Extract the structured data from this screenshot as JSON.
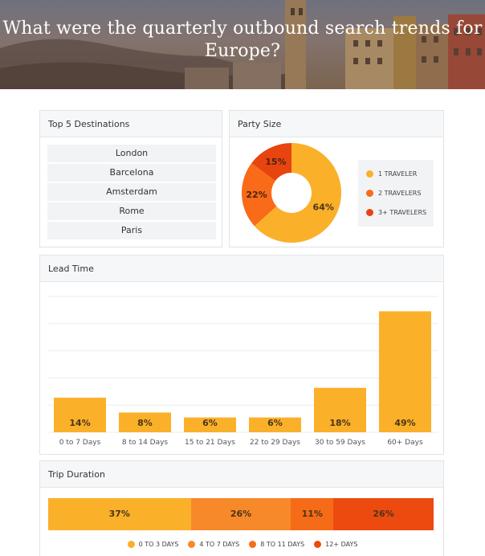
{
  "hero": {
    "title": "What were the quarterly outbound search trends for Europe?"
  },
  "destinations": {
    "title": "Top 5 Destinations",
    "items": [
      "London",
      "Barcelona",
      "Amsterdam",
      "Rome",
      "Paris"
    ]
  },
  "colors": {
    "yellow": "#fbb02a",
    "orange": "#f7842a",
    "dark_orange": "#f2621e",
    "red": "#e8440f"
  },
  "chart_data": [
    {
      "type": "pie",
      "title": "Party Size",
      "donut": true,
      "slices": [
        {
          "label": "1 TRAVELER",
          "value": 64,
          "display": "64%",
          "color": "#fbb02a"
        },
        {
          "label": "2 TRAVELERS",
          "value": 22,
          "display": "22%",
          "color": "#f96a19"
        },
        {
          "label": "3+ TRAVELERS",
          "value": 15,
          "display": "15%",
          "color": "#e8440f"
        }
      ],
      "legend": "right"
    },
    {
      "type": "bar",
      "title": "Lead Time",
      "categories": [
        "0 to 7 Days",
        "8 to 14 Days",
        "15 to 21 Days",
        "22 to 29 Days",
        "30 to 59 Days",
        "60+ Days"
      ],
      "values": [
        14,
        8,
        6,
        6,
        18,
        49
      ],
      "labels": [
        "14%",
        "8%",
        "6%",
        "6%",
        "18%",
        "49%"
      ],
      "ylim": [
        0,
        55
      ],
      "grid": true,
      "color": "#fbb02a"
    },
    {
      "type": "bar",
      "stacked": true,
      "orientation": "horizontal",
      "title": "Trip Duration",
      "series": [
        {
          "name": "0 TO 3 DAYS",
          "value": 37,
          "label": "37%",
          "color": "#fbb02a"
        },
        {
          "name": "4 TO 7 DAYS",
          "value": 26,
          "label": "26%",
          "color": "#f8892a"
        },
        {
          "name": "8 TO 11 DAYS",
          "value": 11,
          "label": "11%",
          "color": "#f66b17"
        },
        {
          "name": "12+ DAYS",
          "value": 26,
          "label": "26%",
          "color": "#ed4a10"
        }
      ],
      "legend": "bottom"
    }
  ]
}
